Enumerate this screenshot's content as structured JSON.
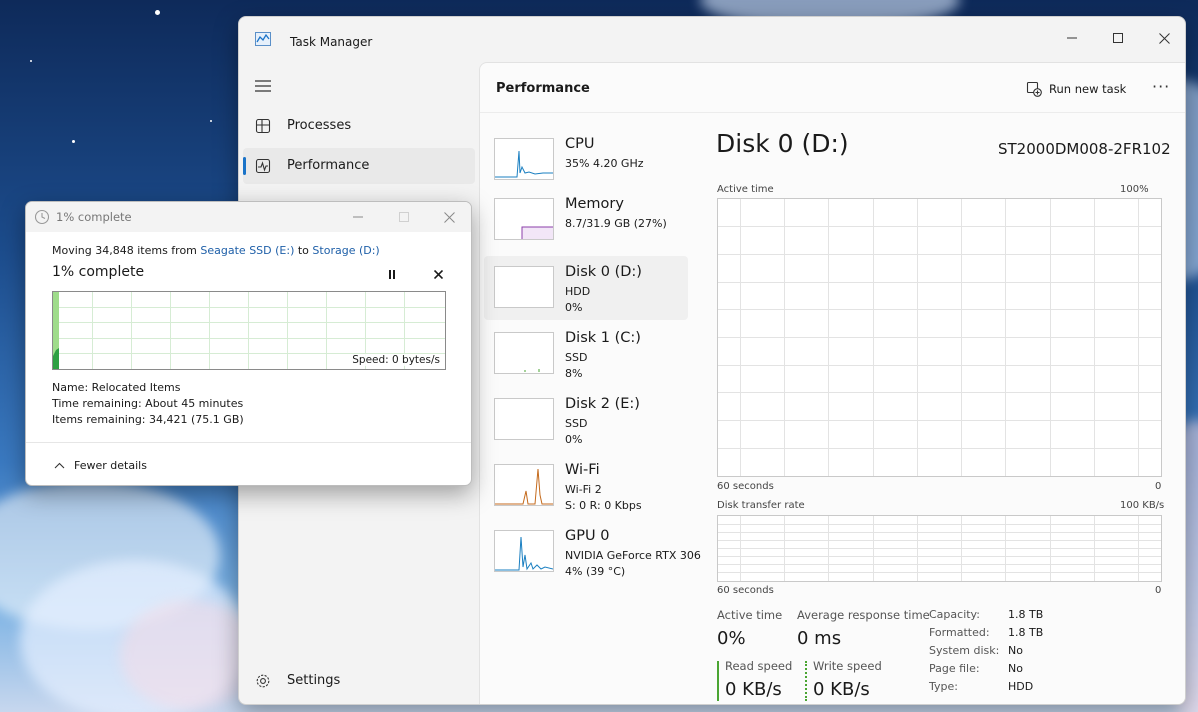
{
  "task_manager": {
    "title": "Task Manager",
    "nav": [
      {
        "label": "Processes"
      },
      {
        "label": "Performance"
      }
    ],
    "settings_label": "Settings",
    "page_title": "Performance",
    "run_new_task": "Run new task",
    "more": "···",
    "devices": [
      {
        "name": "CPU",
        "line1": "35%  4.20 GHz",
        "line2": "",
        "color": "#1a7fc1"
      },
      {
        "name": "Memory",
        "line1": "8.7/31.9 GB (27%)",
        "line2": "",
        "color": "#8b3ea8"
      },
      {
        "name": "Disk 0 (D:)",
        "line1": "HDD",
        "line2": "0%",
        "color": "#4aa532"
      },
      {
        "name": "Disk 1 (C:)",
        "line1": "SSD",
        "line2": "8%",
        "color": "#4aa532"
      },
      {
        "name": "Disk 2 (E:)",
        "line1": "SSD",
        "line2": "0%",
        "color": "#4aa532"
      },
      {
        "name": "Wi-Fi",
        "line1": "Wi-Fi 2",
        "line2": "S: 0  R: 0 Kbps",
        "color": "#c46a1c"
      },
      {
        "name": "GPU 0",
        "line1": "NVIDIA GeForce RTX 306",
        "line2": "4%  (39 °C)",
        "color": "#1a7fc1"
      }
    ],
    "detail": {
      "title": "Disk 0 (D:)",
      "model": "ST2000DM008-2FR102",
      "active_time_label": "Active time",
      "active_time_max": "100%",
      "graph1_time": "60 seconds",
      "graph1_min": "0",
      "transfer_label": "Disk transfer rate",
      "transfer_max": "100 KB/s",
      "graph2_time": "60 seconds",
      "graph2_min": "0",
      "stats": {
        "active_time": {
          "label": "Active time",
          "value": "0%"
        },
        "avg_response": {
          "label": "Average response time",
          "value": "0 ms"
        },
        "read_speed": {
          "label": "Read speed",
          "value": "0 KB/s"
        },
        "write_speed": {
          "label": "Write speed",
          "value": "0 KB/s"
        }
      },
      "props": [
        {
          "label": "Capacity:",
          "value": "1.8 TB"
        },
        {
          "label": "Formatted:",
          "value": "1.8 TB"
        },
        {
          "label": "System disk:",
          "value": "No"
        },
        {
          "label": "Page file:",
          "value": "No"
        },
        {
          "label": "Type:",
          "value": "HDD"
        }
      ]
    }
  },
  "copy_dialog": {
    "title": "1% complete",
    "moving_prefix": "Moving 34,848 items from ",
    "source": "Seagate SSD (E:)",
    "to_word": " to ",
    "destination": "Storage (D:)",
    "percent": "1% complete",
    "progress_fraction": 0.01,
    "speed": "Speed: 0 bytes/s",
    "name_label": "Name:",
    "name_value": "Relocated Items",
    "time_label": "Time remaining:",
    "time_value": "About 45 minutes",
    "items_label": "Items remaining:",
    "items_value": "34,421 (75.1 GB)",
    "fewer_details": "Fewer details"
  },
  "colors": {
    "accent": "#1a73c8",
    "disk_green": "#4aa532",
    "link": "#1e5fa8"
  }
}
